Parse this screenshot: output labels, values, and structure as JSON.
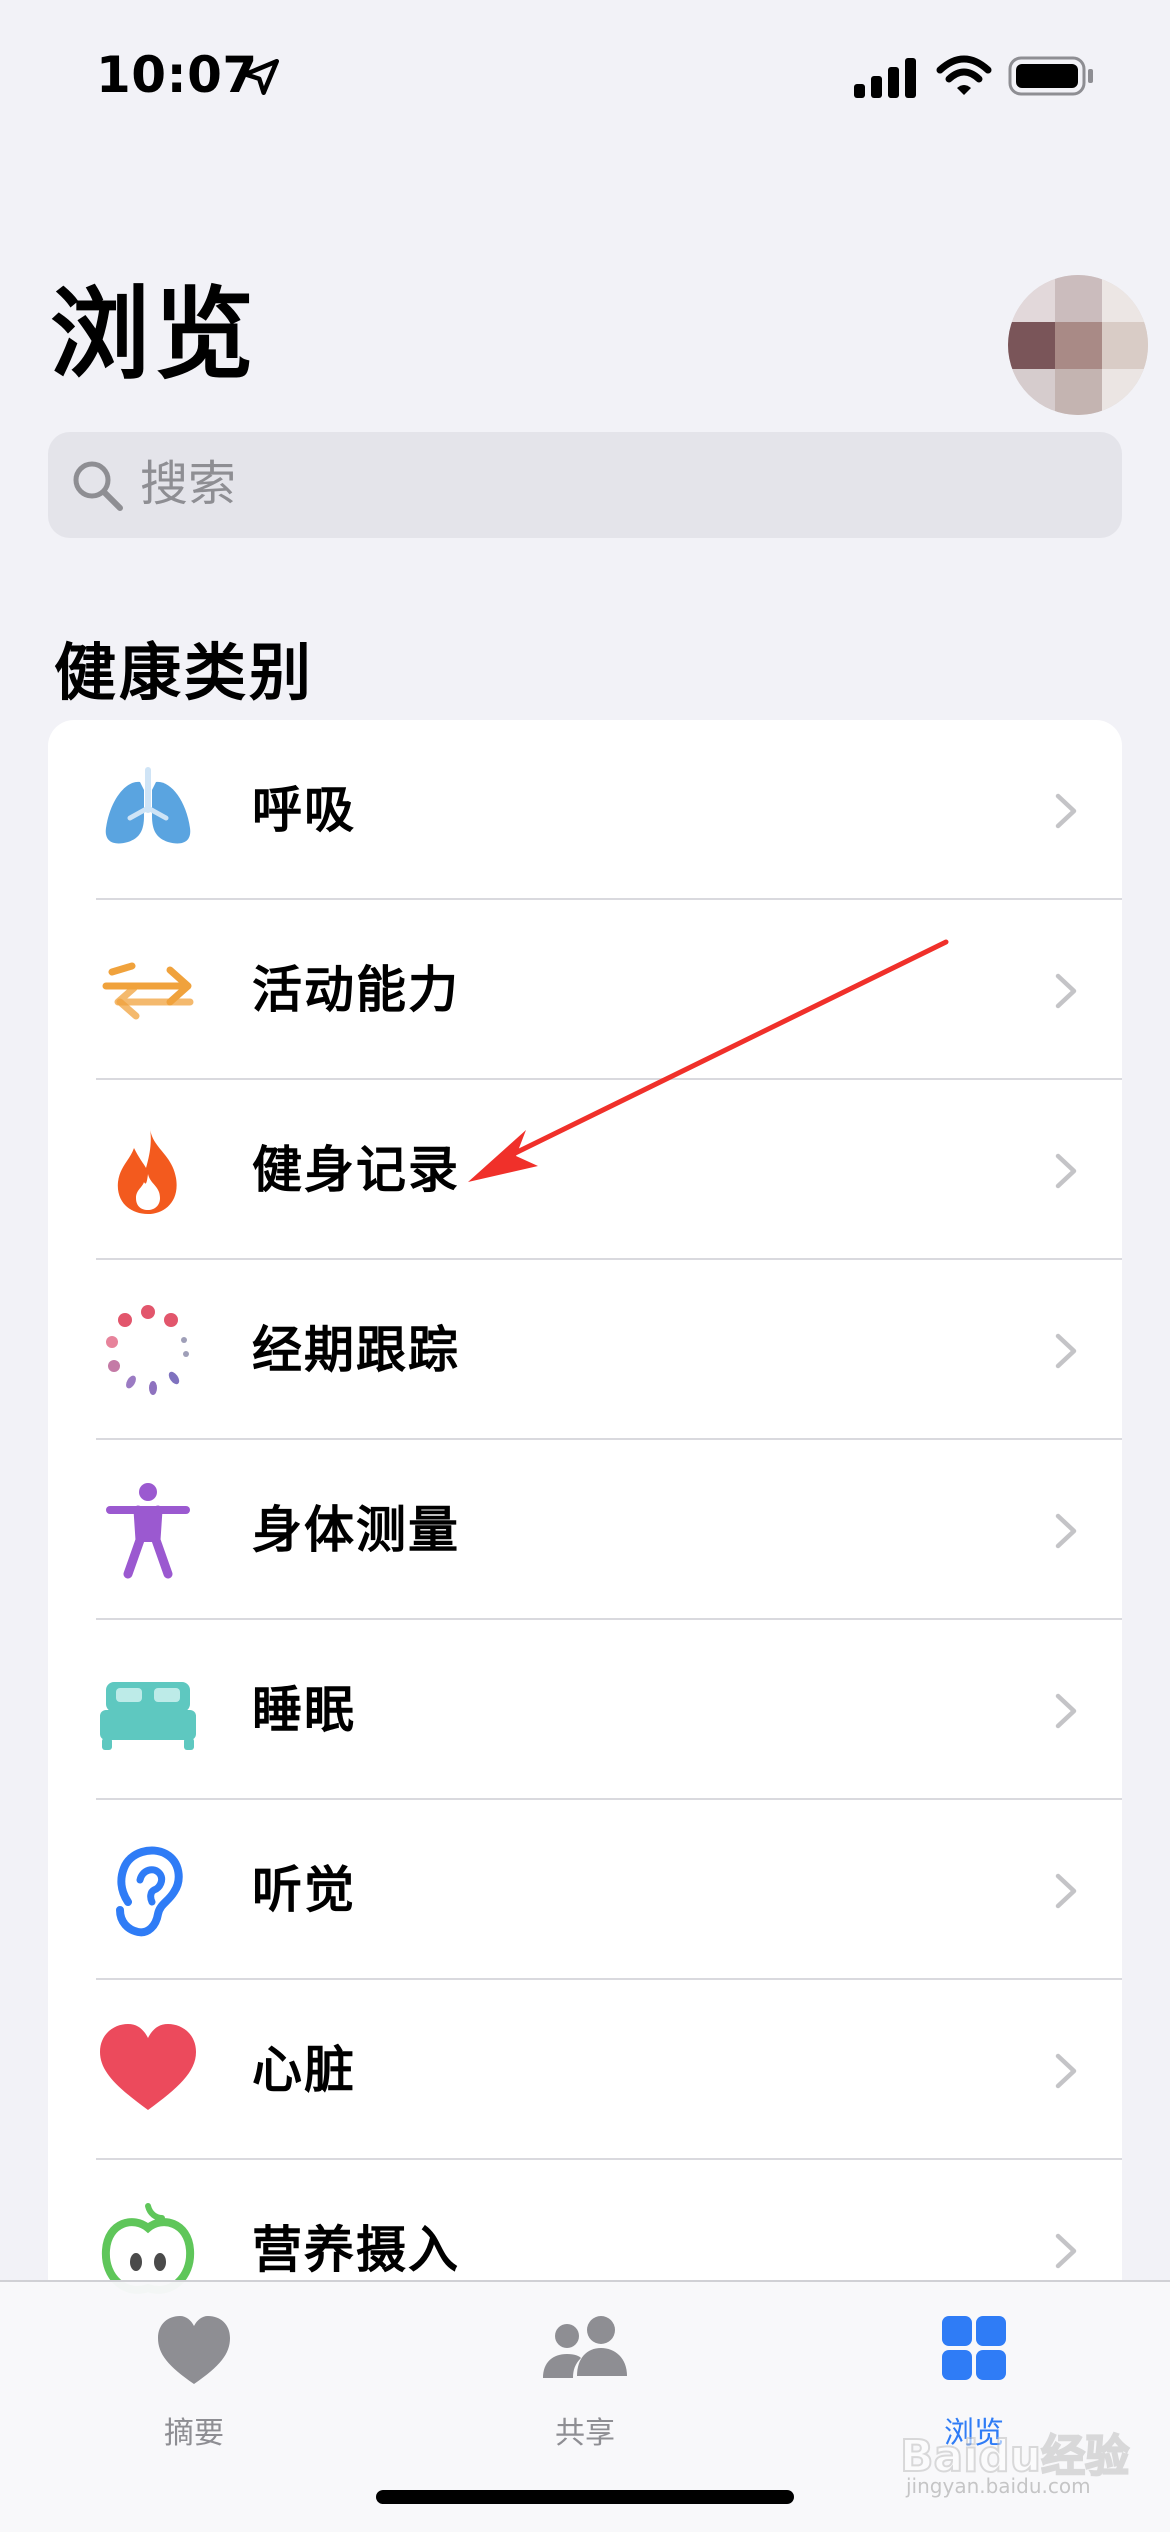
{
  "status_bar": {
    "time": "10:07",
    "icons": [
      "location-arrow-icon",
      "cellular-signal-icon",
      "wifi-icon",
      "battery-icon"
    ]
  },
  "header": {
    "title": "浏览",
    "avatar": "pixelated-profile-photo"
  },
  "search": {
    "placeholder": "搜索",
    "icon": "magnifying-glass-icon"
  },
  "section": {
    "title": "健康类别"
  },
  "categories": [
    {
      "label": "呼吸",
      "icon": "lungs-icon",
      "color": "#5aa4e0"
    },
    {
      "label": "活动能力",
      "icon": "arrows-left-right-icon",
      "color": "#f0a23c"
    },
    {
      "label": "健身记录",
      "icon": "flame-icon",
      "color": "#f35a1e"
    },
    {
      "label": "经期跟踪",
      "icon": "cycle-dots-icon",
      "color": "#e2566c"
    },
    {
      "label": "身体测量",
      "icon": "figure-icon",
      "color": "#9b59d0"
    },
    {
      "label": "睡眠",
      "icon": "bed-icon",
      "color": "#5ec8c0"
    },
    {
      "label": "听觉",
      "icon": "ear-icon",
      "color": "#2f7cf6"
    },
    {
      "label": "心脏",
      "icon": "heart-icon",
      "color": "#ec4a5c"
    },
    {
      "label": "营养摄入",
      "icon": "apple-icon",
      "color": "#5fc65a"
    }
  ],
  "tab_bar": {
    "tabs": [
      {
        "label": "摘要",
        "icon": "heart-icon",
        "active": false
      },
      {
        "label": "共享",
        "icon": "people-icon",
        "active": false
      },
      {
        "label": "浏览",
        "icon": "grid-icon",
        "active": true
      }
    ],
    "active_color": "#2f7cf6",
    "inactive_color": "#8e8e93"
  },
  "annotation": {
    "type": "red-arrow",
    "color": "#f0302a",
    "points_to": "健身记录"
  },
  "watermark": {
    "main": "Baidu经验",
    "sub": "jingyan.baidu.com"
  }
}
